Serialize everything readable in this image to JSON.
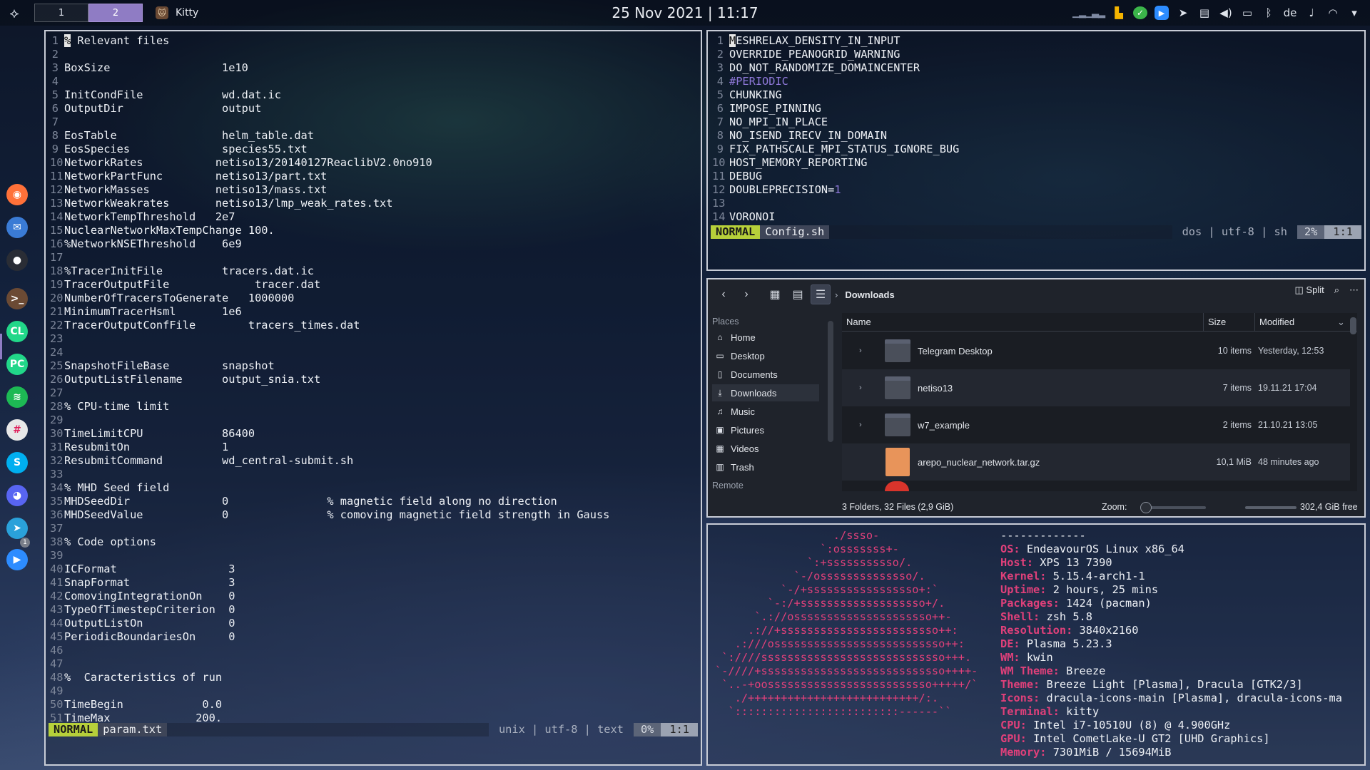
{
  "topbar": {
    "workspaces": [
      "1",
      "2"
    ],
    "active_task": "Kitty",
    "clock": "25 Nov 2021 | 11:17",
    "tray": {
      "language": "de"
    }
  },
  "dock": {
    "apps": [
      {
        "name": "firefox",
        "color": "#ff7139",
        "glyph": "◉"
      },
      {
        "name": "thunderbird",
        "color": "#3a7bd5",
        "glyph": "✉"
      },
      {
        "name": "app-dark",
        "color": "#2a2d35",
        "glyph": "●"
      },
      {
        "name": "kitty",
        "color": "#6b4a34",
        "glyph": ">_"
      },
      {
        "name": "clion",
        "color": "#21d789",
        "glyph": "CL"
      },
      {
        "name": "pycharm",
        "color": "#21d789",
        "glyph": "PC"
      },
      {
        "name": "spotify",
        "color": "#1db954",
        "glyph": "≋"
      },
      {
        "name": "slack",
        "color": "#e8e8e8",
        "glyph": "#"
      },
      {
        "name": "skype",
        "color": "#00aff0",
        "glyph": "S"
      },
      {
        "name": "discord",
        "color": "#5865f2",
        "glyph": "◕"
      },
      {
        "name": "telegram",
        "color": "#2aa1da",
        "glyph": "➤"
      },
      {
        "name": "zoom",
        "color": "#2d8cff",
        "glyph": "▶"
      }
    ],
    "telegram_badge": "1"
  },
  "vim_left": {
    "lines": [
      {
        "n": "1",
        "t": "% Relevant files",
        "cursor": true
      },
      {
        "n": "2",
        "t": ""
      },
      {
        "n": "3",
        "t": "BoxSize                 1e10"
      },
      {
        "n": "4",
        "t": ""
      },
      {
        "n": "5",
        "t": "InitCondFile            wd.dat.ic"
      },
      {
        "n": "6",
        "t": "OutputDir               output"
      },
      {
        "n": "7",
        "t": ""
      },
      {
        "n": "8",
        "t": "EosTable                helm_table.dat"
      },
      {
        "n": "9",
        "t": "EosSpecies              species55.txt"
      },
      {
        "n": "10",
        "t": "NetworkRates           netiso13/20140127ReaclibV2.0no910"
      },
      {
        "n": "11",
        "t": "NetworkPartFunc        netiso13/part.txt"
      },
      {
        "n": "12",
        "t": "NetworkMasses          netiso13/mass.txt"
      },
      {
        "n": "13",
        "t": "NetworkWeakrates       netiso13/lmp_weak_rates.txt"
      },
      {
        "n": "14",
        "t": "NetworkTempThreshold   2e7"
      },
      {
        "n": "15",
        "t": "NuclearNetworkMaxTempChange 100."
      },
      {
        "n": "16",
        "t": "%NetworkNSEThreshold    6e9"
      },
      {
        "n": "17",
        "t": ""
      },
      {
        "n": "18",
        "t": "%TracerInitFile         tracers.dat.ic"
      },
      {
        "n": "19",
        "t": "TracerOutputFile             tracer.dat"
      },
      {
        "n": "20",
        "t": "NumberOfTracersToGenerate   1000000"
      },
      {
        "n": "21",
        "t": "MinimumTracerHsml       1e6"
      },
      {
        "n": "22",
        "t": "TracerOutputConfFile        tracers_times.dat"
      },
      {
        "n": "23",
        "t": ""
      },
      {
        "n": "24",
        "t": ""
      },
      {
        "n": "25",
        "t": "SnapshotFileBase        snapshot"
      },
      {
        "n": "26",
        "t": "OutputListFilename      output_snia.txt"
      },
      {
        "n": "27",
        "t": ""
      },
      {
        "n": "28",
        "t": "% CPU-time limit"
      },
      {
        "n": "29",
        "t": ""
      },
      {
        "n": "30",
        "t": "TimeLimitCPU            86400"
      },
      {
        "n": "31",
        "t": "ResubmitOn              1"
      },
      {
        "n": "32",
        "t": "ResubmitCommand         wd_central-submit.sh"
      },
      {
        "n": "33",
        "t": ""
      },
      {
        "n": "34",
        "t": "% MHD Seed field"
      },
      {
        "n": "35",
        "t": "MHDSeedDir              0               % magnetic field along no direction"
      },
      {
        "n": "36",
        "t": "MHDSeedValue            0               % comoving magnetic field strength in Gauss"
      },
      {
        "n": "37",
        "t": ""
      },
      {
        "n": "38",
        "t": "% Code options"
      },
      {
        "n": "39",
        "t": ""
      },
      {
        "n": "40",
        "t": "ICFormat                 3"
      },
      {
        "n": "41",
        "t": "SnapFormat               3"
      },
      {
        "n": "42",
        "t": "ComovingIntegrationOn    0"
      },
      {
        "n": "43",
        "t": "TypeOfTimestepCriterion  0"
      },
      {
        "n": "44",
        "t": "OutputListOn             0"
      },
      {
        "n": "45",
        "t": "PeriodicBoundariesOn     0"
      },
      {
        "n": "46",
        "t": ""
      },
      {
        "n": "47",
        "t": ""
      },
      {
        "n": "48",
        "t": "%  Caracteristics of run"
      },
      {
        "n": "49",
        "t": ""
      },
      {
        "n": "50",
        "t": "TimeBegin            0.0"
      },
      {
        "n": "51",
        "t": "TimeMax             200."
      }
    ],
    "status": {
      "mode": "NORMAL",
      "file": "param.txt",
      "info": "unix | utf-8 | text",
      "pct": "0%",
      "pos": "1:1"
    }
  },
  "vim_right": {
    "lines": [
      {
        "n": "1",
        "t": "MESHRELAX_DENSITY_IN_INPUT",
        "cursor": true
      },
      {
        "n": "2",
        "t": "OVERRIDE_PEANOGRID_WARNING"
      },
      {
        "n": "3",
        "t": "DO_NOT_RANDOMIZE_DOMAINCENTER"
      },
      {
        "n": "4",
        "t": "#PERIODIC",
        "comment": true
      },
      {
        "n": "5",
        "t": "CHUNKING"
      },
      {
        "n": "6",
        "t": "IMPOSE_PINNING"
      },
      {
        "n": "7",
        "t": "NO_MPI_IN_PLACE"
      },
      {
        "n": "8",
        "t": "NO_ISEND_IRECV_IN_DOMAIN"
      },
      {
        "n": "9",
        "t": "FIX_PATHSCALE_MPI_STATUS_IGNORE_BUG"
      },
      {
        "n": "10",
        "t": "HOST_MEMORY_REPORTING"
      },
      {
        "n": "11",
        "t": "DEBUG"
      },
      {
        "n": "12",
        "t": "DOUBLEPRECISION=1"
      },
      {
        "n": "13",
        "t": ""
      },
      {
        "n": "14",
        "t": "VORONOI"
      }
    ],
    "status": {
      "mode": "NORMAL",
      "file": "Config.sh",
      "info": "dos | utf-8 | sh",
      "pct": "2%",
      "pos": "1:1"
    }
  },
  "dolphin": {
    "breadcrumb": "Downloads",
    "split_label": "Split",
    "places_header": "Places",
    "remote_header": "Remote",
    "places": [
      {
        "label": "Home",
        "icon": "⌂"
      },
      {
        "label": "Desktop",
        "icon": "▭"
      },
      {
        "label": "Documents",
        "icon": "▯"
      },
      {
        "label": "Downloads",
        "icon": "⤓"
      },
      {
        "label": "Music",
        "icon": "♫"
      },
      {
        "label": "Pictures",
        "icon": "▣"
      },
      {
        "label": "Videos",
        "icon": "▦"
      },
      {
        "label": "Trash",
        "icon": "▥"
      }
    ],
    "columns": {
      "name": "Name",
      "size": "Size",
      "modified": "Modified"
    },
    "files": [
      {
        "name": "Telegram Desktop",
        "size": "10 items",
        "modified": "Yesterday, 12:53",
        "type": "folder"
      },
      {
        "name": "netiso13",
        "size": "7 items",
        "modified": "19.11.21 17:04",
        "type": "folder"
      },
      {
        "name": "w7_example",
        "size": "2 items",
        "modified": "21.10.21 13:05",
        "type": "folder"
      },
      {
        "name": "arepo_nuclear_network.tar.gz",
        "size": "10,1 MiB",
        "modified": "48 minutes ago",
        "type": "archive"
      }
    ],
    "status": {
      "summary": "3 Folders, 32 Files (2,9 GiB)",
      "zoom_label": "Zoom:",
      "free": "302,4 GiB free"
    }
  },
  "neofetch": {
    "art": [
      "                  ./ssso-",
      "                `:osssssss+-",
      "              `:+sssssssssso/.",
      "            `-/ossssssssssssso/.",
      "          `-/+sssssssssssssssso+:`",
      "        `-:/+sssssssssssssssssso+/.",
      "      `.://osssssssssssssssssssso++-",
      "     .://+ssssssssssssssssssssssso++:",
      "   .:///ossssssssssssssssssssssssso++:",
      " `:////ssssssssssssssssssssssssssso+++.",
      "`-////+ssssssssssssssssssssssssssso++++-",
      " `..-+oosssssssssssssssssssssssso+++++/`",
      "   ./++++++++++++++++++++++++++/:.",
      "  `:::::::::::::::::::::::::------``"
    ],
    "separator": "-------------",
    "info": [
      {
        "k": "OS",
        "v": "EndeavourOS Linux x86_64"
      },
      {
        "k": "Host",
        "v": "XPS 13 7390"
      },
      {
        "k": "Kernel",
        "v": "5.15.4-arch1-1"
      },
      {
        "k": "Uptime",
        "v": "2 hours, 25 mins"
      },
      {
        "k": "Packages",
        "v": "1424 (pacman)"
      },
      {
        "k": "Shell",
        "v": "zsh 5.8"
      },
      {
        "k": "Resolution",
        "v": "3840x2160"
      },
      {
        "k": "DE",
        "v": "Plasma 5.23.3"
      },
      {
        "k": "WM",
        "v": "kwin"
      },
      {
        "k": "WM Theme",
        "v": "Breeze"
      },
      {
        "k": "Theme",
        "v": "Breeze Light [Plasma], Dracula [GTK2/3]"
      },
      {
        "k": "Icons",
        "v": "dracula-icons-main [Plasma], dracula-icons-ma"
      },
      {
        "k": "Terminal",
        "v": "kitty"
      },
      {
        "k": "CPU",
        "v": "Intel i7-10510U (8) @ 4.900GHz"
      },
      {
        "k": "GPU",
        "v": "Intel CometLake-U GT2 [UHD Graphics]"
      },
      {
        "k": "Memory",
        "v": "7301MiB / 15694MiB"
      }
    ]
  }
}
